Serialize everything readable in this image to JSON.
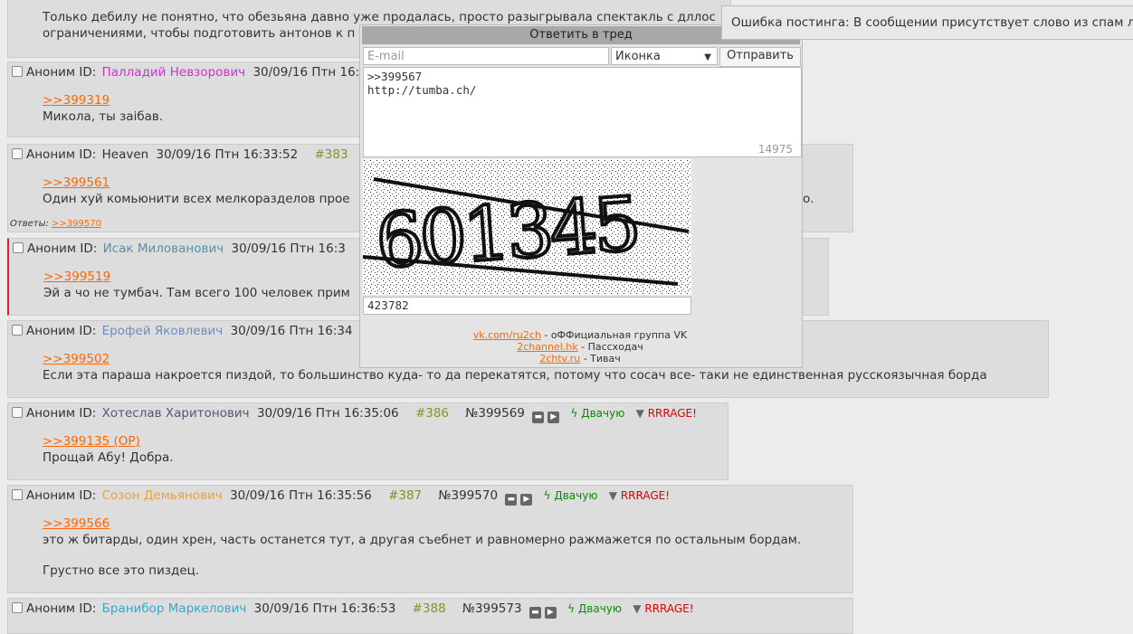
{
  "posts": [
    {
      "text": [
        "Только дебилу не понятно, что обезьяна давно уже продалась, просто разыгрывала спектакль с дллос",
        "ограничениями, чтобы подготовить антонов к п"
      ]
    },
    {
      "anon": "Аноним ID:",
      "nick": "Палладий Невзорович",
      "nick_color": "#cc33cc",
      "date": "30/09/16 Птн 16:",
      "reply": ">>399319",
      "text": [
        "Микола, ты заiбав."
      ]
    },
    {
      "anon": "Аноним ID:",
      "nick": "Heaven",
      "nick_color": "#333333",
      "date": "30/09/16 Птн 16:33:52",
      "postnum": "#383",
      "reply": ">>399561",
      "text": [
        "Один хуй комьюнити всех мелкоразделов прое",
        "о."
      ],
      "answers_label": "Ответы:",
      "answers_link": ">>399570"
    },
    {
      "anon": "Аноним ID:",
      "nick": "Исак Милованович",
      "nick_color": "#5b8fa8",
      "date": "30/09/16 Птн 16:3",
      "reply": ">>399519",
      "text": [
        "Эй а чо не тумбач. Там всего 100 человек прим"
      ]
    },
    {
      "anon": "Аноним ID:",
      "nick": "Ерофей Яковлевич",
      "nick_color": "#6a8fbf",
      "date": "30/09/16 Птн 16:34",
      "reply": ">>399502",
      "text": [
        "Если эта параша накроется пиздой, то большинство куда- то да перекатятся, потому что сосач все- таки не единственная русскоязычная борда"
      ]
    },
    {
      "anon": "Аноним ID:",
      "nick": "Хотеслав Харитонович",
      "nick_color": "#555577",
      "date": "30/09/16 Птн 16:35:06",
      "postnum": "#386",
      "number": "№399569",
      "like": "Двачую",
      "dislike": "RRRAGE!",
      "reply": ">>399135 (OP)",
      "text": [
        "Прощай Абу! Добра."
      ]
    },
    {
      "anon": "Аноним ID:",
      "nick": "Созон Демьянович",
      "nick_color": "#e8a040",
      "date": "30/09/16 Птн 16:35:56",
      "postnum": "#387",
      "number": "№399570",
      "like": "Двачую",
      "dislike": "RRRAGE!",
      "reply": ">>399566",
      "text": [
        "это ж битарды, один хрен, часть останется тут, а другая съебнет и равномерно ражмажется по остальным бордам.",
        "Грустно все это пиздец."
      ]
    },
    {
      "anon": "Аноним ID:",
      "nick": "Бранибор  Маркелович",
      "nick_color": "#33aacc",
      "date": "30/09/16 Птн 16:36:53",
      "postnum": "#388",
      "number": "№399573",
      "like": "Двачую",
      "dislike": "RRRAGE!"
    }
  ],
  "reply_form": {
    "title": "Ответить в тред",
    "email_placeholder": "E-mail",
    "icon_select": "Иконка",
    "send_label": "Отправить",
    "message": ">>399567\nhttp://tumba.ch/",
    "char_count": "14975",
    "captcha_text": "601345",
    "captcha_input": "423782",
    "links": [
      {
        "link": "vk.com/ru2ch",
        "desc": " - оФФициальная группа VK"
      },
      {
        "link": "2channel.hk",
        "desc": " - Пассходач"
      },
      {
        "link": "2chtv.ru",
        "desc": " - Тивач"
      }
    ]
  },
  "error": "Ошибка постинга: В сообщении присутствует слово из спам листа."
}
